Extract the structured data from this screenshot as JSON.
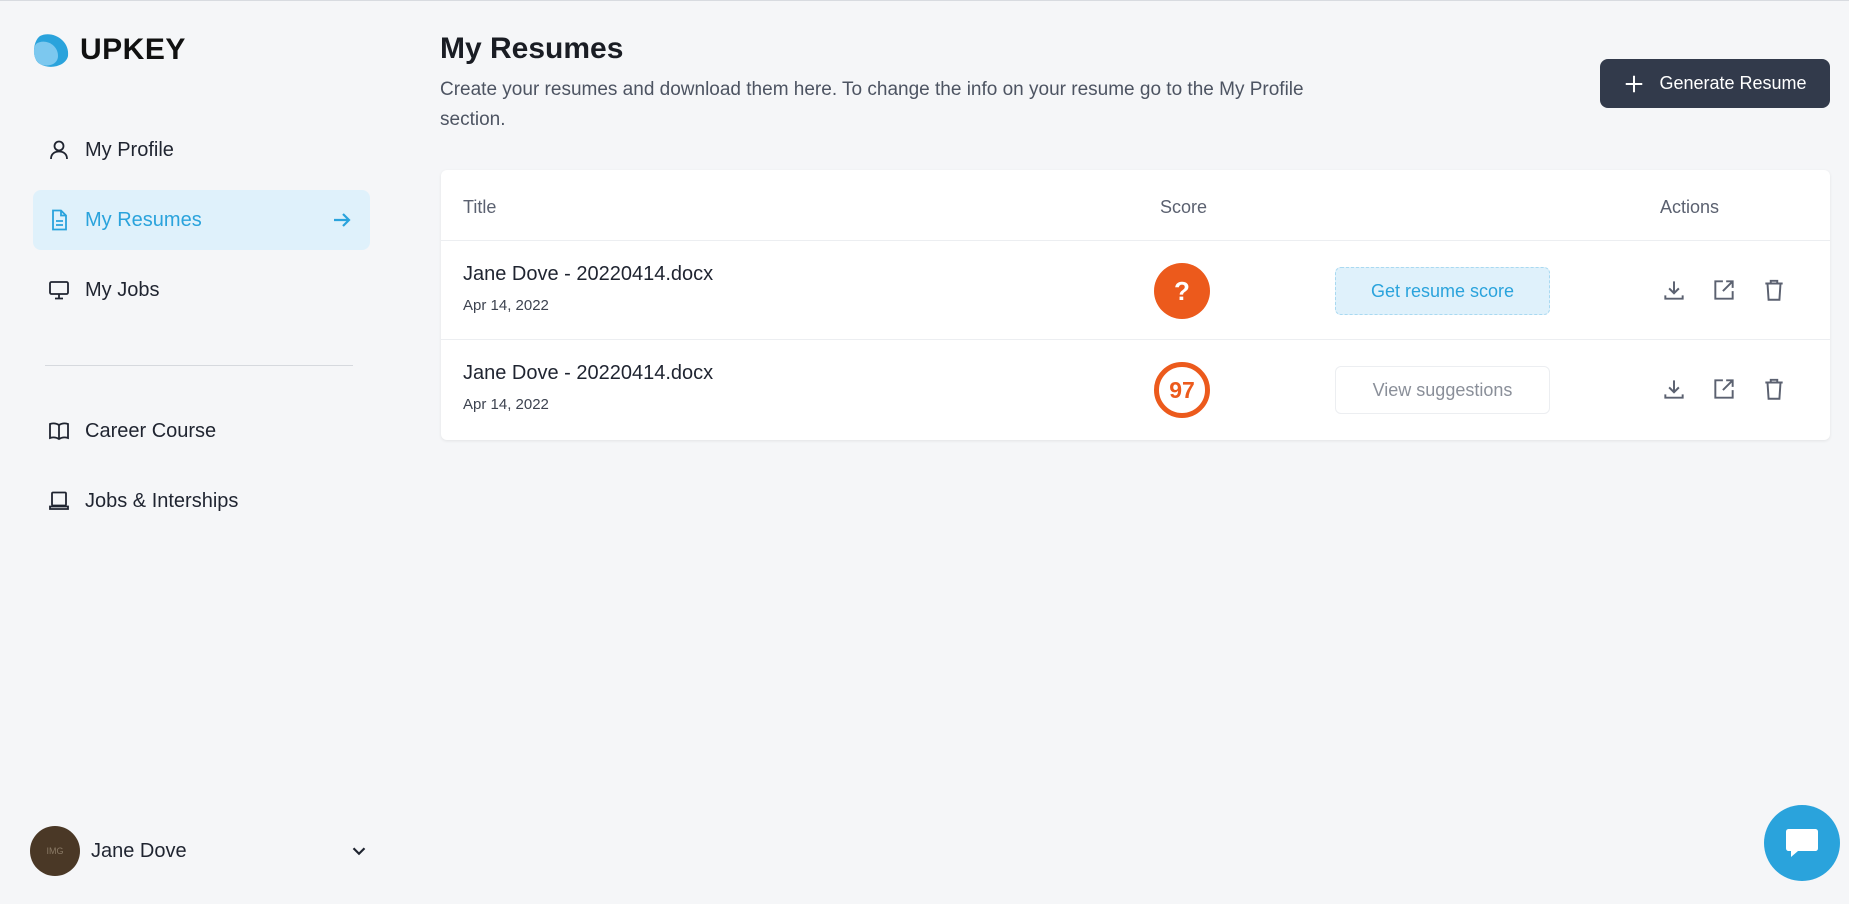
{
  "brand": {
    "name": "UPKEY",
    "accent": "#2aa3dc"
  },
  "sidebar": {
    "items": [
      {
        "label": "My Profile",
        "icon": "user-icon",
        "active": false
      },
      {
        "label": "My Resumes",
        "icon": "document-icon",
        "active": true
      },
      {
        "label": "My Jobs",
        "icon": "monitor-icon",
        "active": false
      },
      {
        "label": "Career Course",
        "icon": "book-icon",
        "active": false
      },
      {
        "label": "Jobs & Interships",
        "icon": "laptop-icon",
        "active": false
      }
    ],
    "user": {
      "name": "Jane Dove",
      "avatar_text": "IMG"
    }
  },
  "header": {
    "title": "My Resumes",
    "subtitle": "Create your resumes and download them here. To change the info on your resume go to the My Profile section.",
    "generate_label": "Generate Resume"
  },
  "table": {
    "columns": {
      "title": "Title",
      "score": "Score",
      "actions": "Actions"
    },
    "rows": [
      {
        "title": "Jane Dove - 20220414.docx",
        "date": "Apr 14, 2022",
        "score": "?",
        "button": "Get resume score"
      },
      {
        "title": "Jane Dove - 20220414.docx",
        "date": "Apr 14, 2022",
        "score": "97",
        "button": "View suggestions"
      }
    ]
  },
  "colors": {
    "score_orange": "#ec5a1c",
    "dark_button": "#323a4b",
    "active_bg": "#dff1fb"
  }
}
